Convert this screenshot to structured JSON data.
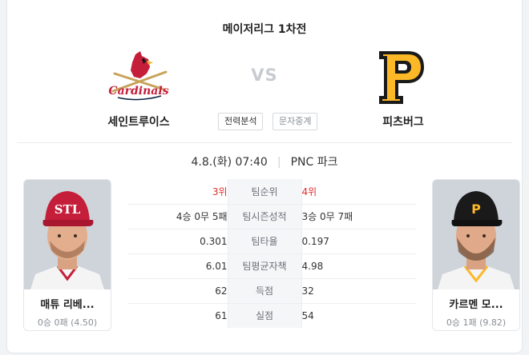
{
  "header": {
    "league_title": "메이저리그 1차전",
    "vs_label": "VS"
  },
  "home_team": {
    "name": "세인트루이스",
    "logo_text": "Cardinals"
  },
  "away_team": {
    "name": "피츠버그",
    "logo_text": "P"
  },
  "buttons": {
    "analysis_label": "전력분석",
    "text_broadcast_label": "문자중계"
  },
  "match_info": {
    "datetime": "4.8.(화) 07:40",
    "stadium": "PNC 파크"
  },
  "home_pitcher": {
    "name": "매튜 리베...",
    "record": "0승 0패 (4.50)",
    "cap_logo": "STL"
  },
  "away_pitcher": {
    "name": "카르멘 모...",
    "record": "0승 1패 (9.82)",
    "cap_logo": "P"
  },
  "stats": [
    {
      "label": "팀순위",
      "home": "3위",
      "away": "4위",
      "highlight": true
    },
    {
      "label": "팀시즌성적",
      "home": "4승 0무 5패",
      "away": "3승 0무 7패",
      "highlight": false
    },
    {
      "label": "팀타율",
      "home": "0.301",
      "away": "0.197",
      "highlight": false
    },
    {
      "label": "팀평균자책",
      "home": "6.01",
      "away": "4.98",
      "highlight": false
    },
    {
      "label": "득점",
      "home": "62",
      "away": "32",
      "highlight": false
    },
    {
      "label": "실점",
      "home": "61",
      "away": "54",
      "highlight": false
    }
  ],
  "colors": {
    "highlight": "#e0302f",
    "cardinals_red": "#c41e3a",
    "pirates_gold": "#fdb827",
    "pirates_black": "#1a1a1a"
  }
}
